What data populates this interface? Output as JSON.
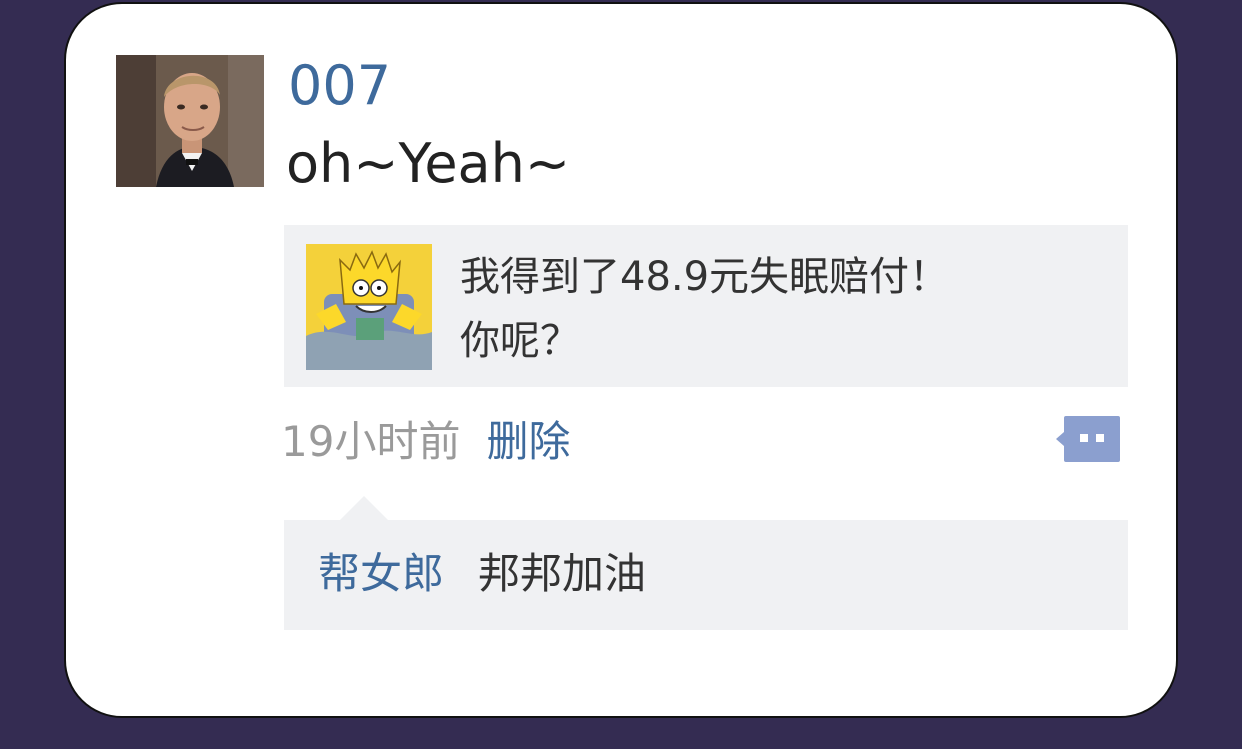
{
  "post": {
    "username": "007",
    "text": "oh~Yeah~",
    "avatar_icon": "avatar-007-photo"
  },
  "share": {
    "line1": "我得到了48.9元失眠赔付！",
    "line2": "你呢？",
    "thumb_icon": "cartoon-thumbnail-icon"
  },
  "meta": {
    "timestamp": "19小时前",
    "delete_label": "删除",
    "comment_icon": "comment-bubble-icon"
  },
  "comments": [
    {
      "author": "帮女郎",
      "text": "邦邦加油"
    }
  ],
  "colors": {
    "background": "#342c52",
    "link": "#3e6a9c",
    "panel": "#f0f1f3",
    "comment_icon": "#8b9fcf"
  }
}
